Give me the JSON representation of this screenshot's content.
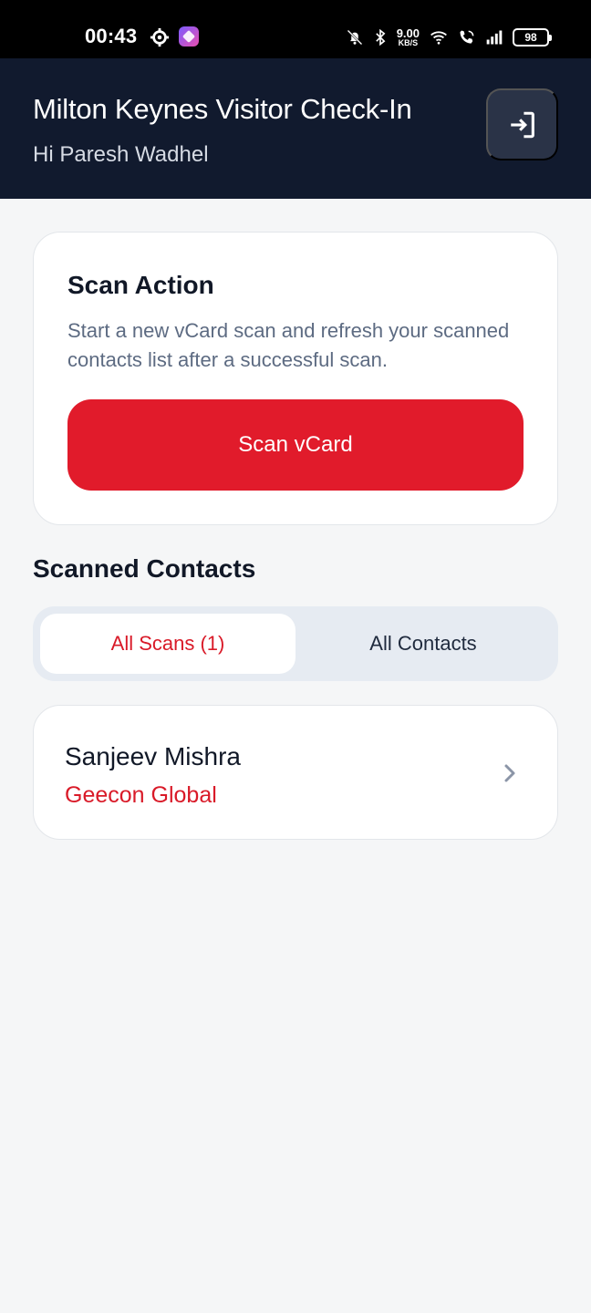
{
  "status_bar": {
    "time": "00:43",
    "net_speed_value": "9.00",
    "net_speed_unit": "KB/S",
    "battery": "98",
    "icons": [
      "settings-gear-icon",
      "app-badge-icon",
      "bell-muted-icon",
      "bluetooth-icon",
      "wifi-icon",
      "wifi-calling-icon",
      "signal-icon",
      "battery-icon"
    ]
  },
  "header": {
    "title": "Milton Keynes Visitor Check-In",
    "greeting": "Hi Paresh Wadhel",
    "exit_icon": "logout-icon"
  },
  "scan_action": {
    "title": "Scan Action",
    "description": "Start a new vCard scan and refresh your scanned contacts list after a successful scan.",
    "button_label": "Scan vCard"
  },
  "contacts": {
    "section_title": "Scanned Contacts",
    "tabs": [
      {
        "label": "All Scans (1)",
        "active": true
      },
      {
        "label": "All Contacts",
        "active": false
      }
    ],
    "items": [
      {
        "name": "Sanjeev Mishra",
        "company": "Geecon Global"
      }
    ]
  },
  "colors": {
    "header_bg": "#111a2e",
    "accent_red": "#e11b2b",
    "page_bg": "#f5f6f7",
    "segment_bg": "#e6ebf2"
  }
}
